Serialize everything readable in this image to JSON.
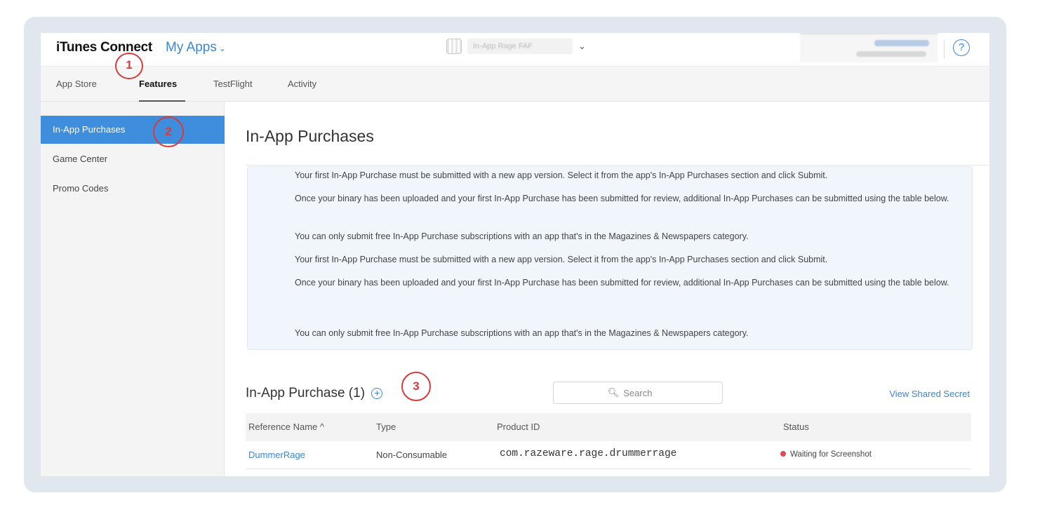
{
  "topbar": {
    "brand": "iTunes Connect",
    "my_apps": "My Apps",
    "app_name": "In-App Rage FAF",
    "help_label": "?"
  },
  "nav": {
    "tabs": [
      {
        "label": "App Store"
      },
      {
        "label": "Features"
      },
      {
        "label": "TestFlight"
      },
      {
        "label": "Activity"
      }
    ]
  },
  "sidebar": {
    "items": [
      {
        "label": "In-App Purchases"
      },
      {
        "label": "Game Center"
      },
      {
        "label": "Promo Codes"
      }
    ]
  },
  "main": {
    "title": "In-App Purchases",
    "info": [
      "Your first In-App Purchase must be submitted with a new app version. Select it from the app's In-App Purchases section and click Submit.",
      "Once your binary has been uploaded and your first In-App Purchase has been submitted for review, additional In-App Purchases can be submitted using the table below.",
      "You can only submit free In-App Purchase subscriptions with an app that's in the Magazines & Newspapers category.",
      "Your first In-App Purchase must be submitted with a new app version. Select it from the app's In-App Purchases section and click Submit.",
      "Once your binary has been uploaded and your first In-App Purchase has been submitted for review, additional In-App Purchases can be submitted using the table below.",
      "You can only submit free In-App Purchase subscriptions with an app that's in the Magazines & Newspapers category."
    ],
    "iap_header": "In-App Purchase (1)",
    "search_placeholder": "Search",
    "view_shared_secret": "View Shared Secret",
    "table": {
      "columns": [
        "Reference Name ^",
        "Type",
        "Product ID",
        "Status"
      ],
      "rows": [
        {
          "name": "DummerRage",
          "type": "Non-Consumable",
          "product_id": "com.razeware.rage.drummerrage",
          "status": "Waiting for Screenshot",
          "status_color": "#e04a55"
        }
      ]
    }
  },
  "callouts": [
    "1",
    "2",
    "3"
  ],
  "colors": {
    "accent": "#3b86d6",
    "callout": "#d83a3a",
    "sidebar_active": "#3f8edd"
  }
}
